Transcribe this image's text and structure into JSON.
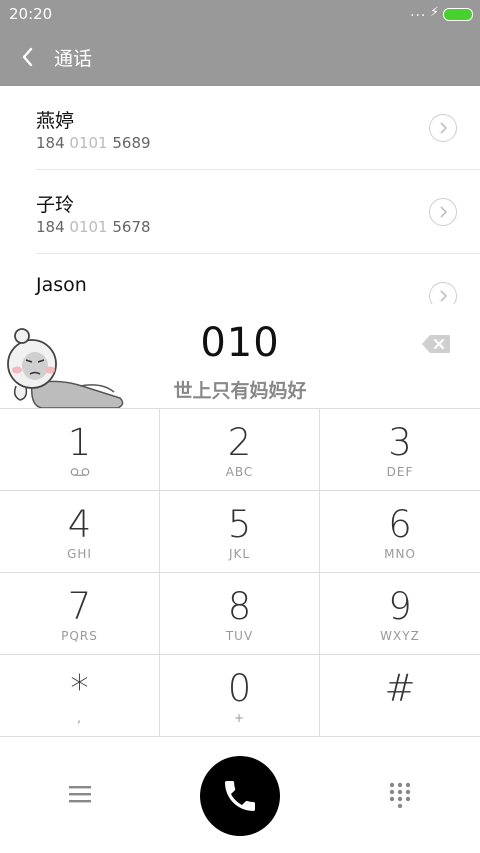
{
  "status_bar": {
    "time": "20:20",
    "signal_dots": "...",
    "battery_color": "#47d12e"
  },
  "header": {
    "title": "通话",
    "background": "#999999"
  },
  "contacts": [
    {
      "name": "燕婷",
      "number_prefix": "184 ",
      "number_match": "0101",
      "number_suffix": " 5689"
    },
    {
      "name": "子玲",
      "number_prefix": "184 ",
      "number_match": "0101",
      "number_suffix": " 5678"
    },
    {
      "name": "Jason",
      "number_prefix": "",
      "number_match": "",
      "number_suffix": ""
    }
  ],
  "dialer": {
    "dialed_number": "010",
    "matched_text": "世上只有妈妈好"
  },
  "keypad": [
    {
      "digit": "1",
      "letters": "voicemail"
    },
    {
      "digit": "2",
      "letters": "ABC"
    },
    {
      "digit": "3",
      "letters": "DEF"
    },
    {
      "digit": "4",
      "letters": "GHI"
    },
    {
      "digit": "5",
      "letters": "JKL"
    },
    {
      "digit": "6",
      "letters": "MNO"
    },
    {
      "digit": "7",
      "letters": "PQRS"
    },
    {
      "digit": "8",
      "letters": "TUV"
    },
    {
      "digit": "9",
      "letters": "WXYZ"
    },
    {
      "digit": "*",
      "letters": ","
    },
    {
      "digit": "0",
      "letters": "+"
    },
    {
      "digit": "#",
      "letters": ""
    }
  ],
  "icons": {
    "back": "back-arrow-icon",
    "detail": "chevron-right-circle-icon",
    "backspace": "backspace-icon",
    "menu": "menu-icon",
    "call": "phone-icon",
    "keypad": "dialpad-icon"
  }
}
